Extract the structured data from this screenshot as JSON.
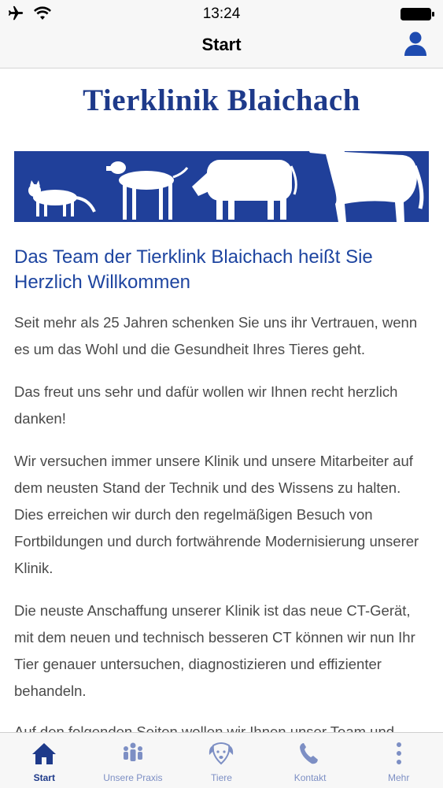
{
  "status_bar": {
    "time": "13:24"
  },
  "nav": {
    "title": "Start"
  },
  "logo": {
    "title": "Tierklinik Blaichach"
  },
  "main": {
    "heading": "Das Team der Tierklink Blaichach heißt Sie Herzlich Willkommen",
    "paragraphs": [
      "Seit mehr als 25 Jahren schenken Sie uns ihr Vertrauen, wenn es um das Wohl und die Gesundheit Ihres Tieres geht.",
      "Das freut uns sehr und dafür wollen wir Ihnen recht herzlich danken!",
      "Wir versuchen immer unsere Klinik und unsere Mitarbeiter auf dem neusten Stand der Technik und des Wissens zu halten. Dies erreichen wir durch den regelmäßigen Besuch von Fortbildungen und durch fortwährende Modernisierung unserer Klinik.",
      "Die neuste Anschaffung unserer Klinik ist das neue CT-Gerät, mit dem neuen und technisch besseren CT können wir nun Ihr Tier genauer untersuchen, diagnostizieren und effizienter behandeln.",
      "Auf den folgenden Seiten wollen wir Ihnen unser Team und"
    ]
  },
  "tabs": [
    {
      "label": "Start",
      "icon": "home-icon"
    },
    {
      "label": "Unsere Praxis",
      "icon": "people-icon"
    },
    {
      "label": "Tiere",
      "icon": "dog-icon"
    },
    {
      "label": "Kontakt",
      "icon": "phone-icon"
    },
    {
      "label": "Mehr",
      "icon": "more-icon"
    }
  ],
  "colors": {
    "brand": "#1e3a8a",
    "banner": "#20409a",
    "tab_inactive": "#7d8fc4"
  }
}
